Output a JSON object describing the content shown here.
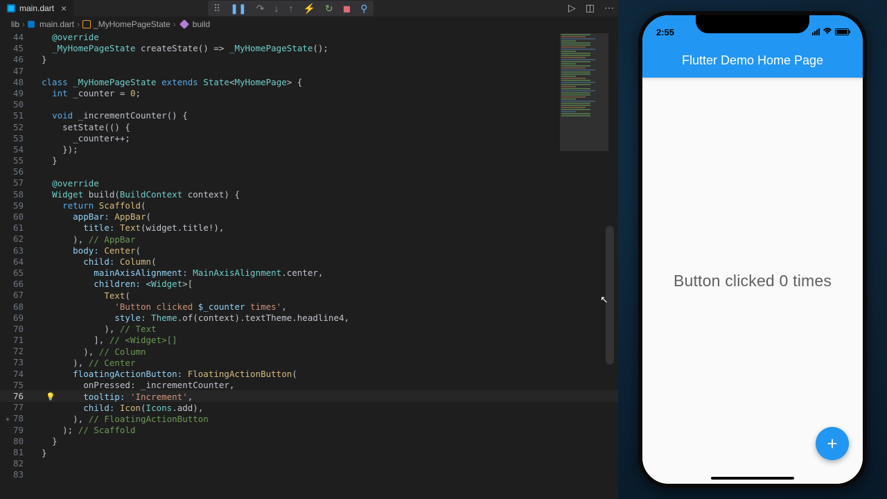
{
  "tab": {
    "filename": "main.dart"
  },
  "breadcrumb": {
    "folder": "lib",
    "file": "main.dart",
    "class": "_MyHomePageState",
    "method": "build"
  },
  "gutter": {
    "start": 44,
    "end": 83,
    "highlighted": 76
  },
  "code": {
    "l44": "",
    "override": "@override",
    "l46_a": "_MyHomePageState",
    "l46_b": " createState() => ",
    "l46_c": "_MyHomePageState",
    "l46_d": "();",
    "l47": "}",
    "l49_a": "class ",
    "l49_b": "_MyHomePageState ",
    "l49_c": "extends ",
    "l49_d": "State",
    "l49_e": "<",
    "l49_f": "MyHomePage",
    "l49_g": "> {",
    "l50_a": "int",
    "l50_b": " _counter = ",
    "l50_c": "0",
    "l50_d": ";",
    "l52_a": "void",
    "l52_b": " _incrementCounter() {",
    "l53": "setState(() {",
    "l54": "_counter++;",
    "l55": "});",
    "l56": "}",
    "l59_a": "Widget",
    "l59_b": " build(",
    "l59_c": "BuildContext",
    "l59_d": " context) {",
    "l60_a": "return ",
    "l60_b": "Scaffold",
    "l60_c": "(",
    "l61_a": "appBar: ",
    "l61_b": "AppBar",
    "l61_c": "(",
    "l62_a": "title: ",
    "l62_b": "Text",
    "l62_c": "(widget.title!),",
    "l63_a": "), ",
    "l63_b": "// AppBar",
    "l64_a": "body: ",
    "l64_b": "Center",
    "l64_c": "(",
    "l65_a": "child: ",
    "l65_b": "Column",
    "l65_c": "(",
    "l66_a": "mainAxisAlignment: ",
    "l66_b": "MainAxisAlignment",
    "l66_c": ".center,",
    "l67_a": "children: <",
    "l67_b": "Widget",
    "l67_c": ">[",
    "l68_a": "Text",
    "l68_b": "(",
    "l69_a": "'Button clicked ",
    "l69_b": "$_counter",
    "l69_c": " times'",
    "l69_d": ",",
    "l70_a": "style: ",
    "l70_b": "Theme",
    "l70_c": ".of(context).textTheme.headline4,",
    "l71_a": "), ",
    "l71_b": "// Text",
    "l72_a": "], ",
    "l72_b": "// <Widget>[]",
    "l73_a": "), ",
    "l73_b": "// Column",
    "l74_a": "), ",
    "l74_b": "// Center",
    "l75_a": "floatingActionButton: ",
    "l75_b": "FloatingActionButton",
    "l75_c": "(",
    "l76_a": "onPressed: _incrementCounter,",
    "l77_a": "tooltip: ",
    "l77_b": "'Increment'",
    "l77_c": ",",
    "l78_a": "child: ",
    "l78_b": "Icon",
    "l78_c": "(",
    "l78_d": "Icons",
    "l78_e": ".add),",
    "l79_a": "),",
    "l79_b": " // FloatingActionButton",
    "l80_a": "); ",
    "l80_b": "// Scaffold",
    "l81": "}",
    "l82": "}"
  },
  "simulator": {
    "time": "2:55",
    "appbar_title": "Flutter Demo Home Page",
    "body_text": "Button clicked 0 times"
  }
}
